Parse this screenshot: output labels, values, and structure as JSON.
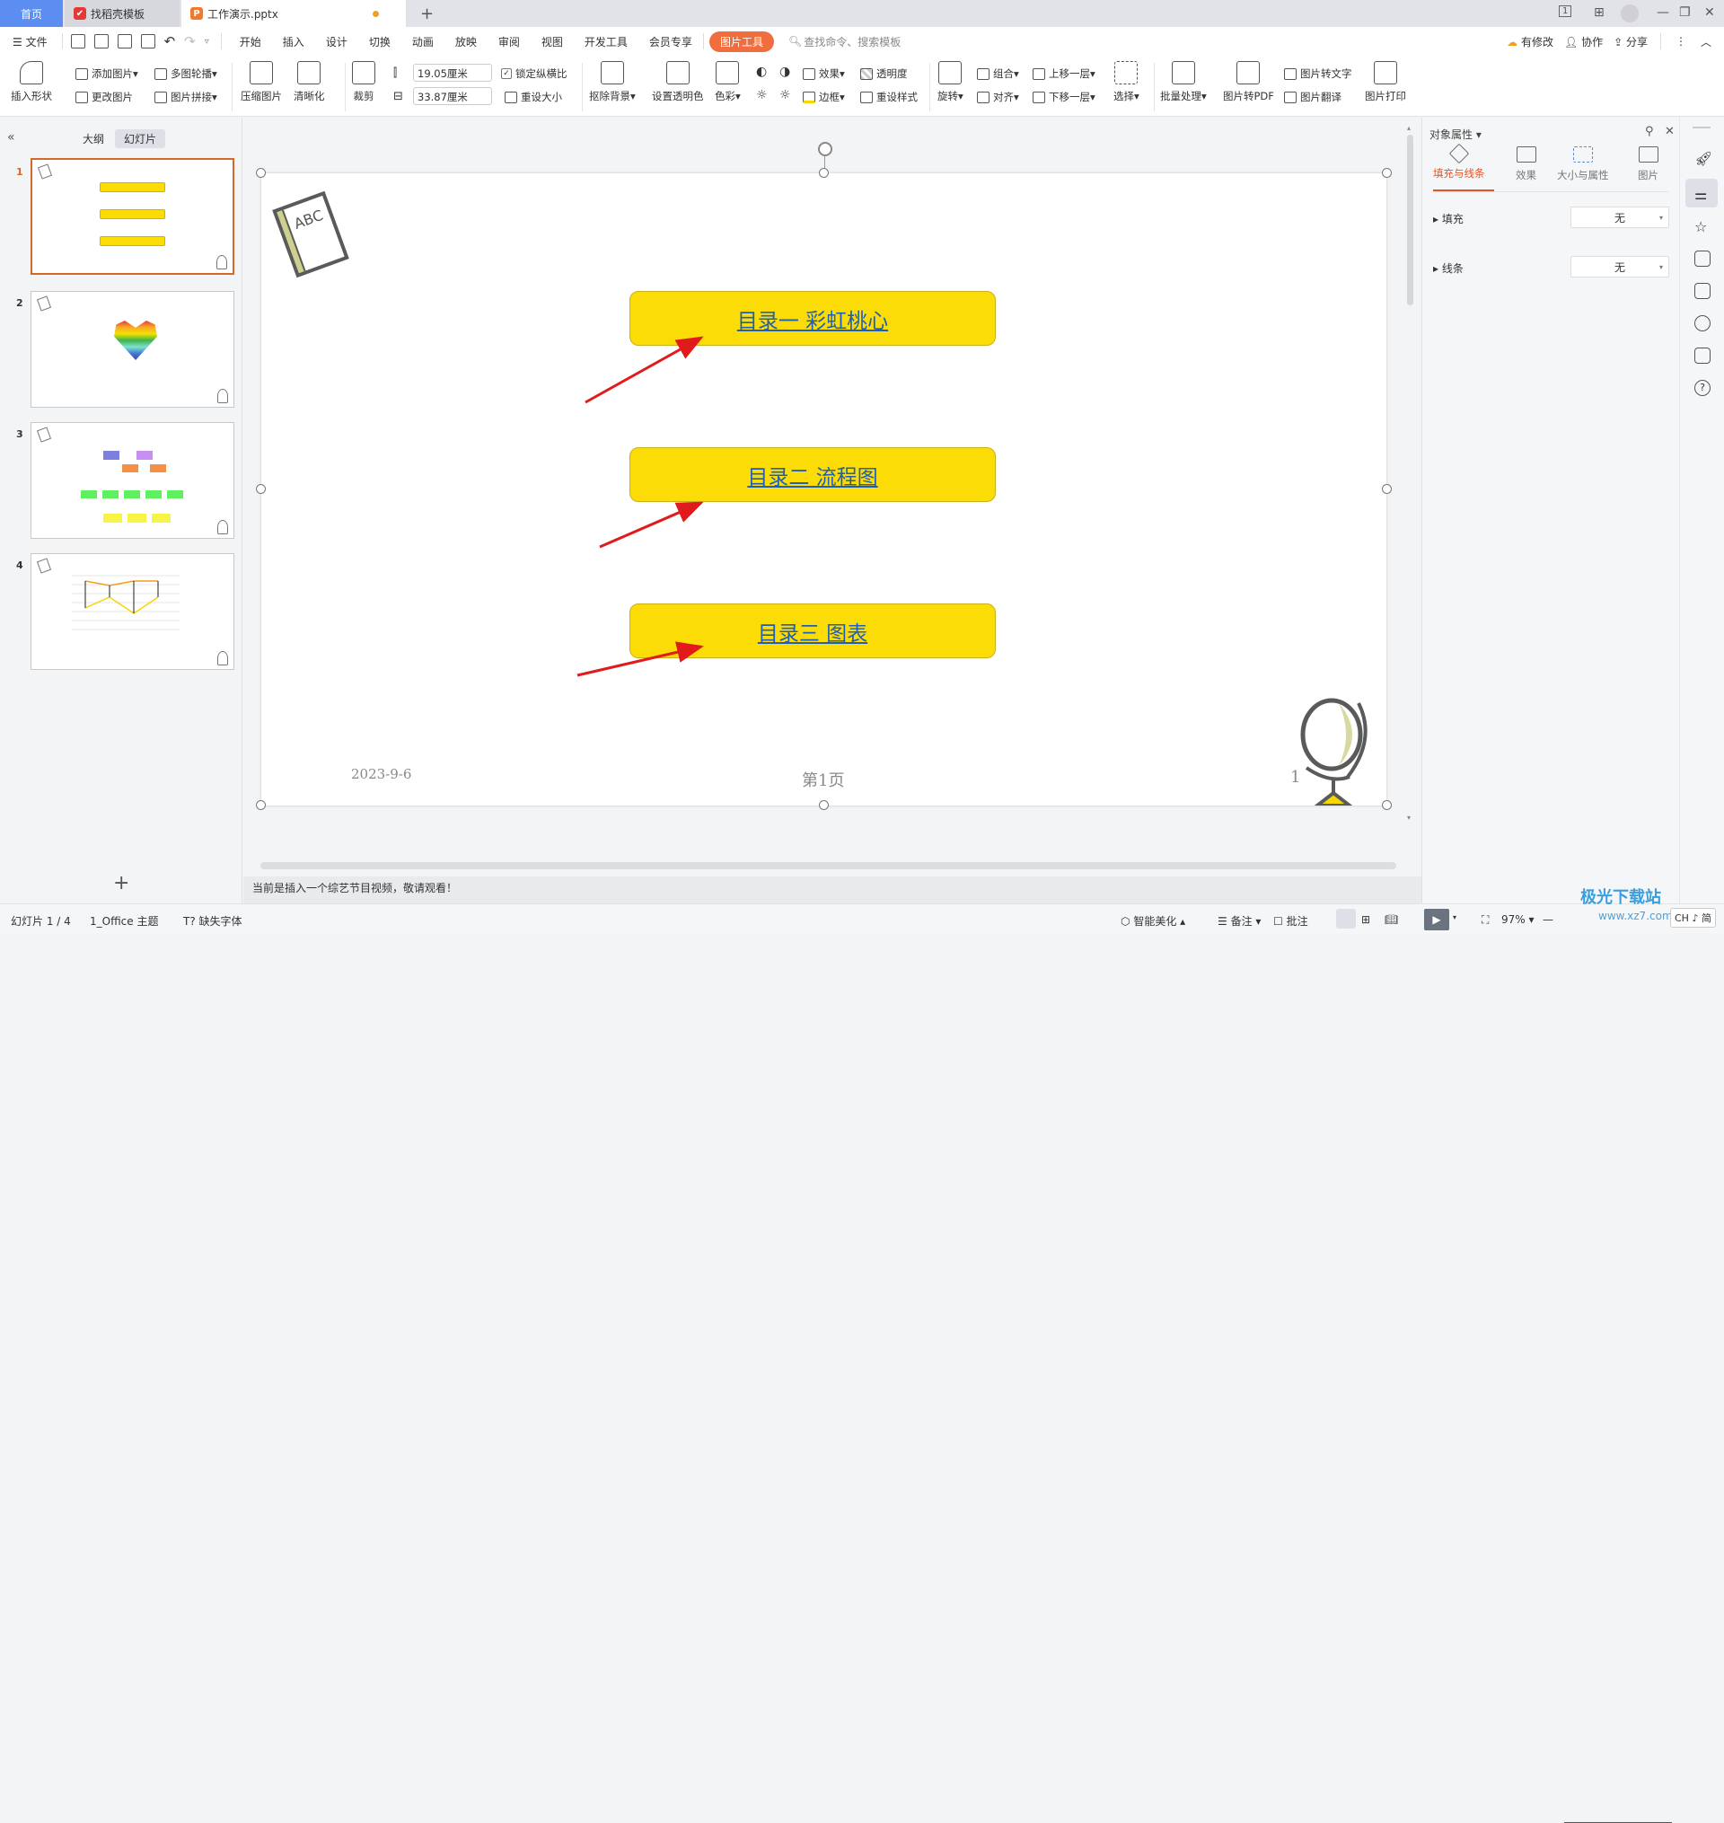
{
  "tabs": {
    "home": "首页",
    "templates": "找稻壳模板",
    "document": "工作演示.pptx",
    "new_tab": "+"
  },
  "title_controls": {
    "slide_count_badge": "1",
    "minimize": "—",
    "restore": "❐",
    "close": "✕"
  },
  "menu": {
    "file": "文件",
    "items": [
      "开始",
      "插入",
      "设计",
      "切换",
      "动画",
      "放映",
      "审阅",
      "视图",
      "开发工具",
      "会员专享"
    ],
    "picture_tools": "图片工具",
    "search_placeholder": "查找命令、搜索模板",
    "modified": "有修改",
    "collaborate": "协作",
    "share": "分享"
  },
  "ribbon": {
    "insert_shape": "插入形状",
    "add_picture": "添加图片",
    "carousel": "多图轮播",
    "change_picture": "更改图片",
    "picture_stitch": "图片拼接",
    "compress": "压缩图片",
    "sharpen": "清晰化",
    "crop": "裁剪",
    "height": "19.05厘米",
    "width": "33.87厘米",
    "lock_ratio": "锁定纵横比",
    "lock_ratio_checked": true,
    "reset_size": "重设大小",
    "remove_bg": "抠除背景",
    "set_transparent": "设置透明色",
    "color": "色彩",
    "effects": "效果",
    "transparency": "透明度",
    "border": "边框",
    "reset_style": "重设样式",
    "rotate": "旋转",
    "group": "组合",
    "align": "对齐",
    "bring_forward": "上移一层",
    "send_backward": "下移一层",
    "select": "选择",
    "batch": "批量处理",
    "to_pdf": "图片转PDF",
    "to_text": "图片转文字",
    "translate": "图片翻译",
    "print": "图片打印"
  },
  "left_panel": {
    "collapse": "«",
    "outline_tab": "大纲",
    "slides_tab": "幻灯片",
    "slides": [
      {
        "number": "1",
        "selected": true,
        "content": "toc"
      },
      {
        "number": "2",
        "selected": false,
        "content": "rainbow-heart"
      },
      {
        "number": "3",
        "selected": false,
        "content": "flowchart"
      },
      {
        "number": "4",
        "selected": false,
        "content": "line-chart"
      }
    ],
    "add_slide": "+"
  },
  "slide": {
    "book_label": "ABC",
    "toc_items": [
      "目录一  彩虹桃心",
      "目录二    流程图",
      "目录三      图表"
    ],
    "date": "2023-9-6",
    "page_label": "第1页",
    "page_number": "1",
    "accent_color": "#fbdc07",
    "link_color": "#1f5fb4",
    "arrow_color": "#e11b1b"
  },
  "notes": "当前是插入一个综艺节目视频，敬请观看！",
  "right_panel": {
    "title": "对象属性",
    "tabs": [
      "填充与线条",
      "效果",
      "大小与属性",
      "图片"
    ],
    "active_tab": 0,
    "fill_label": "填充",
    "fill_value": "无",
    "line_label": "线条",
    "line_value": "无"
  },
  "status": {
    "slide_info": "幻灯片 1 / 4",
    "theme": "1_Office 主题",
    "missing_font": "缺失字体",
    "smart_beautify": "智能美化",
    "notes": "备注",
    "comments": "批注",
    "zoom": "97%",
    "watermark": "极光下载站",
    "watermark_url": "www.xz7.com",
    "ime": "CH ♪ 简"
  }
}
